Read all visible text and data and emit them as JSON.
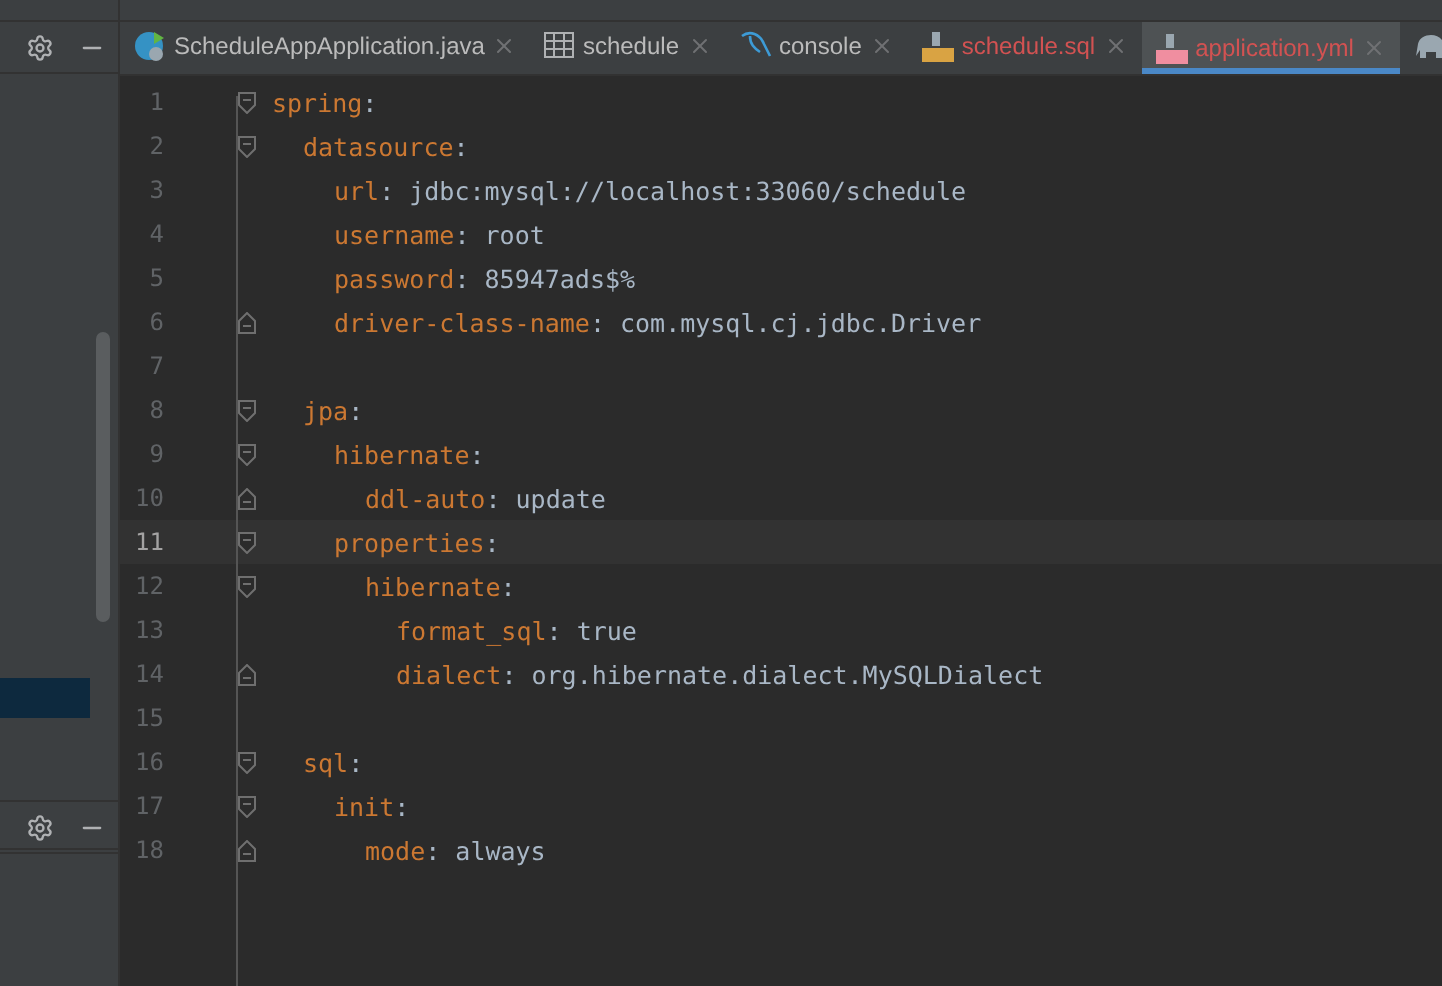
{
  "tabs": [
    {
      "label": "ScheduleAppApplication.java",
      "kind": "java",
      "selected": false,
      "color": "#bbbbbb"
    },
    {
      "label": "schedule",
      "kind": "table",
      "selected": false,
      "color": "#bbbbbb"
    },
    {
      "label": "console",
      "kind": "console",
      "selected": false,
      "color": "#bbbbbb"
    },
    {
      "label": "schedule.sql",
      "kind": "sql",
      "selected": false,
      "color": "#d25252"
    },
    {
      "label": "application.yml",
      "kind": "yml",
      "selected": true,
      "color": "#d25252"
    },
    {
      "kind": "elephant",
      "selected": false
    }
  ],
  "line_numbers": [
    "1",
    "2",
    "3",
    "4",
    "5",
    "6",
    "7",
    "8",
    "9",
    "10",
    "11",
    "12",
    "13",
    "14",
    "15",
    "16",
    "17",
    "18"
  ],
  "code": [
    {
      "key": "spring:",
      "current": false,
      "children": [
        {
          "key": "datasource:",
          "current": false,
          "children": [
            {
              "key": "url:",
              "value": "jdbc:mysql://localhost:33060/schedule",
              "current": false
            },
            {
              "key": "username:",
              "value": "root",
              "current": false
            },
            {
              "key": "password:",
              "value": "85947ads$%",
              "current": false
            },
            {
              "key": "driver-class-name:",
              "value": "com.mysql.cj.jdbc.Driver",
              "current": false
            }
          ]
        },
        {
          "current": false
        },
        {
          "key": "jpa:",
          "current": false,
          "children": [
            {
              "key": "hibernate:",
              "current": false,
              "children": [
                {
                  "key": "ddl-auto:",
                  "value": "update",
                  "current": false
                }
              ]
            },
            {
              "key": "properties:",
              "current": true,
              "children": [
                {
                  "key": "hibernate:",
                  "current": false,
                  "children": [
                    {
                      "key": "format_sql:",
                      "value": "true",
                      "current": false
                    },
                    {
                      "key": "dialect:",
                      "value": "org.hibernate.dialect.MySQLDialect",
                      "current": false
                    }
                  ]
                }
              ]
            }
          ]
        },
        {
          "current": false
        },
        {
          "key": "sql:",
          "current": false,
          "children": [
            {
              "key": "init:",
              "current": false,
              "children": [
                {
                  "key": "mode:",
                  "value": "always",
                  "current": false
                }
              ]
            }
          ]
        }
      ]
    }
  ]
}
